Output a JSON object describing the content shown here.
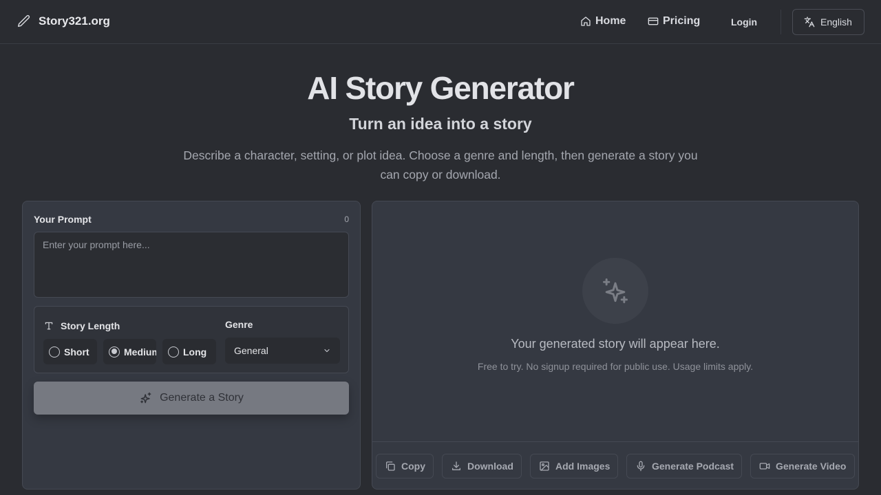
{
  "header": {
    "brand_name": "Story321.org",
    "nav": {
      "home_label": "Home",
      "pricing_label": "Pricing",
      "login_label": "Login"
    },
    "language_label": "English"
  },
  "hero": {
    "title": "AI Story Generator",
    "subtitle": "Turn an idea into a story",
    "description": "Describe a character, setting, or plot idea. Choose a genre and length, then generate a story you can copy or download."
  },
  "prompt_panel": {
    "prompt_label": "Your Prompt",
    "char_count": "0",
    "prompt_value": "",
    "prompt_placeholder": "Enter your prompt here...",
    "length_label": "Story Length",
    "length_options": [
      {
        "label": "Short",
        "selected": false
      },
      {
        "label": "Medium",
        "selected": true
      },
      {
        "label": "Long",
        "selected": false
      }
    ],
    "genre_label": "Genre",
    "genre_selected": "General",
    "generate_label": "Generate a Story"
  },
  "output_panel": {
    "empty_title": "Your generated story will appear here.",
    "empty_subtitle": "Free to try. No signup required for public use. Usage limits apply.",
    "actions": {
      "copy_label": "Copy",
      "download_label": "Download",
      "add_images_label": "Add Images",
      "podcast_label": "Generate Podcast",
      "video_label": "Generate Video"
    }
  },
  "icons": {
    "brand": "pencil-icon",
    "home": "home-icon",
    "pricing": "credit-card-icon",
    "language": "translate-icon",
    "length": "text-type-icon",
    "genre": "chevron-down-icon",
    "generate": "sparkles-icon",
    "placeholder": "sparkles-icon",
    "copy": "copy-icon",
    "download": "download-icon",
    "images": "image-icon",
    "podcast": "microphone-icon",
    "video": "video-camera-icon"
  },
  "colors": {
    "page_bg": "#2a2c31",
    "panel_bg": "#353942",
    "generate_button_bg": "#767981",
    "text_primary": "#e6e7ea",
    "text_muted": "#a4a7af"
  }
}
